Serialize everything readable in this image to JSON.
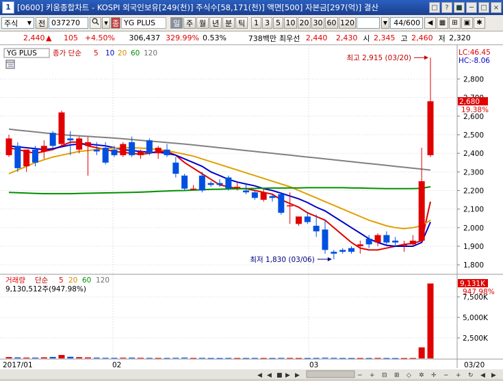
{
  "window": {
    "badge": "1",
    "title": "[0600] 키움종합차트 - KOSPI 외국인보유[249(천)] 주식수[58,171(천)] 액면[500] 자본금[297(억)] 결산",
    "buttons": [
      "□",
      "?",
      "■",
      "─",
      "□",
      "×"
    ]
  },
  "toolbar": {
    "market": "주식",
    "market_sub": "전",
    "code": "037270",
    "stock_name": "YG PLUS",
    "stock_prefix": "종",
    "period_tabs": [
      "일",
      "주",
      "월",
      "년",
      "분",
      "틱"
    ],
    "active_period": "일",
    "intervals": [
      "1",
      "3",
      "5",
      "10",
      "20",
      "30",
      "60",
      "120"
    ],
    "count": "44/600"
  },
  "pricebar": {
    "price": "2,440",
    "arrow": "▲",
    "change": "105",
    "change_pct": "+4.50%",
    "volume": "306,437",
    "volume_ratio": "329.99%",
    "turnover": "0.53%",
    "amount": "738백만",
    "best_label": "최우선",
    "ask": "2,440",
    "bid": "2,430",
    "open_label": "시",
    "open": "2,345",
    "high_label": "고",
    "high": "2,460",
    "low_label": "저",
    "low": "2,320"
  },
  "price_panel": {
    "legend_name": "YG PLUS",
    "legend_line": "종가 단순",
    "ma_periods": [
      "5",
      "10",
      "20",
      "60",
      "120"
    ],
    "ma_colors": [
      "#e00000",
      "#0000cc",
      "#e0a000",
      "#009000",
      "#808080"
    ],
    "lc_label": "LC:46.45",
    "hc_label": "HC:-8.06",
    "current_price": "2,680",
    "current_change": "19.38%",
    "high_annotation": "최고 2,915 (03/20)",
    "low_annotation": "최저 1,830 (03/06)",
    "y_ticks": [
      "2,800",
      "2,700",
      "2,600",
      "2,500",
      "2,400",
      "2,300",
      "2,200",
      "2,100",
      "2,000",
      "1,900",
      "1,800"
    ]
  },
  "volume_panel": {
    "legend_name": "거래량",
    "legend_line": "단순",
    "ma_periods": [
      "5",
      "20",
      "60",
      "120"
    ],
    "summary": "9,130,512주(947.98%)",
    "current_label": "9,131K",
    "current_pct": "947.98%",
    "y_ticks": [
      "7,500K",
      "5,000K",
      "2,500K"
    ]
  },
  "x_axis": {
    "labels": [
      "2017/01",
      "02",
      "03"
    ],
    "right_label": "03/20"
  },
  "chart_data": {
    "type": "candlestick",
    "candles": [
      {
        "o": 2390,
        "h": 2500,
        "l": 2380,
        "c": 2480
      },
      {
        "o": 2440,
        "h": 2460,
        "l": 2300,
        "c": 2320
      },
      {
        "o": 2330,
        "h": 2420,
        "l": 2300,
        "c": 2420
      },
      {
        "o": 2420,
        "h": 2440,
        "l": 2330,
        "c": 2350
      },
      {
        "o": 2410,
        "h": 2470,
        "l": 2370,
        "c": 2440
      },
      {
        "o": 2510,
        "h": 2520,
        "l": 2430,
        "c": 2440
      },
      {
        "o": 2450,
        "h": 2630,
        "l": 2430,
        "c": 2620
      },
      {
        "o": 2480,
        "h": 2520,
        "l": 2390,
        "c": 2470
      },
      {
        "o": 2420,
        "h": 2490,
        "l": 2400,
        "c": 2480
      },
      {
        "o": 2440,
        "h": 2490,
        "l": 2280,
        "c": 2460
      },
      {
        "o": 2420,
        "h": 2460,
        "l": 2390,
        "c": 2410
      },
      {
        "o": 2430,
        "h": 2460,
        "l": 2340,
        "c": 2350
      },
      {
        "o": 2420,
        "h": 2440,
        "l": 2380,
        "c": 2390
      },
      {
        "o": 2390,
        "h": 2460,
        "l": 2380,
        "c": 2450
      },
      {
        "o": 2460,
        "h": 2490,
        "l": 2380,
        "c": 2390
      },
      {
        "o": 2390,
        "h": 2420,
        "l": 2370,
        "c": 2410
      },
      {
        "o": 2470,
        "h": 2480,
        "l": 2390,
        "c": 2400
      },
      {
        "o": 2400,
        "h": 2440,
        "l": 2370,
        "c": 2430
      },
      {
        "o": 2420,
        "h": 2450,
        "l": 2380,
        "c": 2390
      },
      {
        "o": 2350,
        "h": 2380,
        "l": 2270,
        "c": 2290
      },
      {
        "o": 2280,
        "h": 2290,
        "l": 2200,
        "c": 2210
      },
      {
        "o": 2210,
        "h": 2230,
        "l": 2200,
        "c": 2210
      },
      {
        "o": 2280,
        "h": 2300,
        "l": 2190,
        "c": 2200
      },
      {
        "o": 2240,
        "h": 2250,
        "l": 2220,
        "c": 2230
      },
      {
        "o": 2240,
        "h": 2260,
        "l": 2220,
        "c": 2230
      },
      {
        "o": 2270,
        "h": 2280,
        "l": 2200,
        "c": 2210
      },
      {
        "o": 2220,
        "h": 2240,
        "l": 2200,
        "c": 2220
      },
      {
        "o": 2200,
        "h": 2240,
        "l": 2180,
        "c": 2190
      },
      {
        "o": 2190,
        "h": 2200,
        "l": 2150,
        "c": 2160
      },
      {
        "o": 2150,
        "h": 2210,
        "l": 2140,
        "c": 2190
      },
      {
        "o": 2170,
        "h": 2180,
        "l": 2140,
        "c": 2160
      },
      {
        "o": 2180,
        "h": 2190,
        "l": 2070,
        "c": 2080
      },
      {
        "o": 2120,
        "h": 2190,
        "l": 2020,
        "c": 2120
      },
      {
        "o": 2020,
        "h": 2060,
        "l": 2010,
        "c": 2060
      },
      {
        "o": 2060,
        "h": 2080,
        "l": 2020,
        "c": 2030
      },
      {
        "o": 2010,
        "h": 2070,
        "l": 1950,
        "c": 1980
      },
      {
        "o": 1990,
        "h": 2040,
        "l": 1860,
        "c": 1880
      },
      {
        "o": 1870,
        "h": 1880,
        "l": 1830,
        "c": 1860
      },
      {
        "o": 1880,
        "h": 1890,
        "l": 1860,
        "c": 1870
      },
      {
        "o": 1890,
        "h": 1900,
        "l": 1860,
        "c": 1870
      },
      {
        "o": 1900,
        "h": 1930,
        "l": 1860,
        "c": 1910
      },
      {
        "o": 1940,
        "h": 1960,
        "l": 1890,
        "c": 1910
      },
      {
        "o": 1920,
        "h": 1970,
        "l": 1900,
        "c": 1960
      },
      {
        "o": 1960,
        "h": 1980,
        "l": 1910,
        "c": 1920
      },
      {
        "o": 1930,
        "h": 1950,
        "l": 1900,
        "c": 1920
      },
      {
        "o": 1910,
        "h": 1930,
        "l": 1870,
        "c": 1910
      },
      {
        "o": 1910,
        "h": 1960,
        "l": 1900,
        "c": 1930
      },
      {
        "o": 1930,
        "h": 2430,
        "l": 1920,
        "c": 2250
      },
      {
        "o": 2390,
        "h": 2915,
        "l": 2380,
        "c": 2680
      }
    ],
    "moving_averages": [
      {
        "period": 5,
        "color": "#e00000",
        "values": [
          2430,
          2420,
          2410,
          2400,
          2410,
          2420,
          2440,
          2460,
          2460,
          2440,
          2430,
          2420,
          2410,
          2405,
          2400,
          2395,
          2400,
          2410,
          2410,
          2390,
          2350,
          2320,
          2290,
          2260,
          2230,
          2220,
          2210,
          2210,
          2200,
          2190,
          2180,
          2150,
          2130,
          2110,
          2080,
          2060,
          2040,
          2000,
          1960,
          1920,
          1890,
          1880,
          1880,
          1890,
          1900,
          1910,
          1915,
          1930,
          2140
        ]
      },
      {
        "period": 10,
        "color": "#0000cc",
        "values": [
          2440,
          2435,
          2430,
          2425,
          2420,
          2425,
          2435,
          2445,
          2450,
          2450,
          2445,
          2440,
          2430,
          2420,
          2415,
          2410,
          2405,
          2405,
          2400,
          2390,
          2370,
          2350,
          2330,
          2300,
          2280,
          2260,
          2245,
          2235,
          2225,
          2210,
          2200,
          2185,
          2170,
          2155,
          2135,
          2110,
          2090,
          2060,
          2030,
          2000,
          1970,
          1940,
          1920,
          1905,
          1900,
          1900,
          1900,
          1920,
          2030
        ]
      },
      {
        "period": 20,
        "color": "#e0a000",
        "values": [
          2290,
          2310,
          2330,
          2350,
          2365,
          2380,
          2390,
          2400,
          2410,
          2415,
          2420,
          2425,
          2428,
          2430,
          2430,
          2428,
          2425,
          2420,
          2415,
          2405,
          2395,
          2385,
          2370,
          2355,
          2340,
          2325,
          2310,
          2295,
          2280,
          2265,
          2250,
          2235,
          2220,
          2200,
          2180,
          2160,
          2140,
          2120,
          2100,
          2080,
          2060,
          2040,
          2025,
          2010,
          2000,
          1995,
          2000,
          2010,
          2040
        ]
      },
      {
        "period": 60,
        "color": "#009000",
        "values": [
          2190,
          2188,
          2186,
          2184,
          2183,
          2183,
          2183,
          2183,
          2184,
          2185,
          2186,
          2187,
          2188,
          2189,
          2190,
          2191,
          2193,
          2195,
          2197,
          2199,
          2200,
          2202,
          2204,
          2206,
          2207,
          2208,
          2209,
          2210,
          2211,
          2212,
          2213,
          2213,
          2214,
          2214,
          2215,
          2215,
          2215,
          2215,
          2215,
          2214,
          2213,
          2212,
          2211,
          2210,
          2210,
          2210,
          2210,
          2212,
          2220
        ]
      },
      {
        "period": 120,
        "color": "#808080",
        "values": [
          2530,
          2525,
          2520,
          2515,
          2510,
          2505,
          2500,
          2497,
          2494,
          2491,
          2488,
          2485,
          2482,
          2478,
          2474,
          2470,
          2466,
          2462,
          2458,
          2454,
          2450,
          2445,
          2440,
          2435,
          2430,
          2425,
          2420,
          2415,
          2410,
          2405,
          2400,
          2395,
          2390,
          2385,
          2380,
          2375,
          2370,
          2365,
          2360,
          2355,
          2350,
          2345,
          2340,
          2335,
          2330,
          2325,
          2320,
          2315,
          2310
        ]
      }
    ],
    "volumes": [
      0.16,
      0.12,
      0.1,
      0.1,
      0.13,
      0.18,
      0.42,
      0.2,
      0.15,
      0.12,
      0.1,
      0.08,
      0.08,
      0.09,
      0.1,
      0.08,
      0.07,
      0.06,
      0.06,
      0.08,
      0.1,
      0.06,
      0.07,
      0.05,
      0.05,
      0.06,
      0.05,
      0.05,
      0.06,
      0.05,
      0.05,
      0.07,
      0.06,
      0.05,
      0.05,
      0.06,
      0.09,
      0.07,
      0.05,
      0.05,
      0.05,
      0.05,
      0.06,
      0.05,
      0.04,
      0.04,
      0.05,
      1.35,
      9.13
    ],
    "volume_unit": "M shares",
    "ylim": [
      1760,
      2960
    ],
    "volume_ylim": [
      0,
      10
    ]
  }
}
